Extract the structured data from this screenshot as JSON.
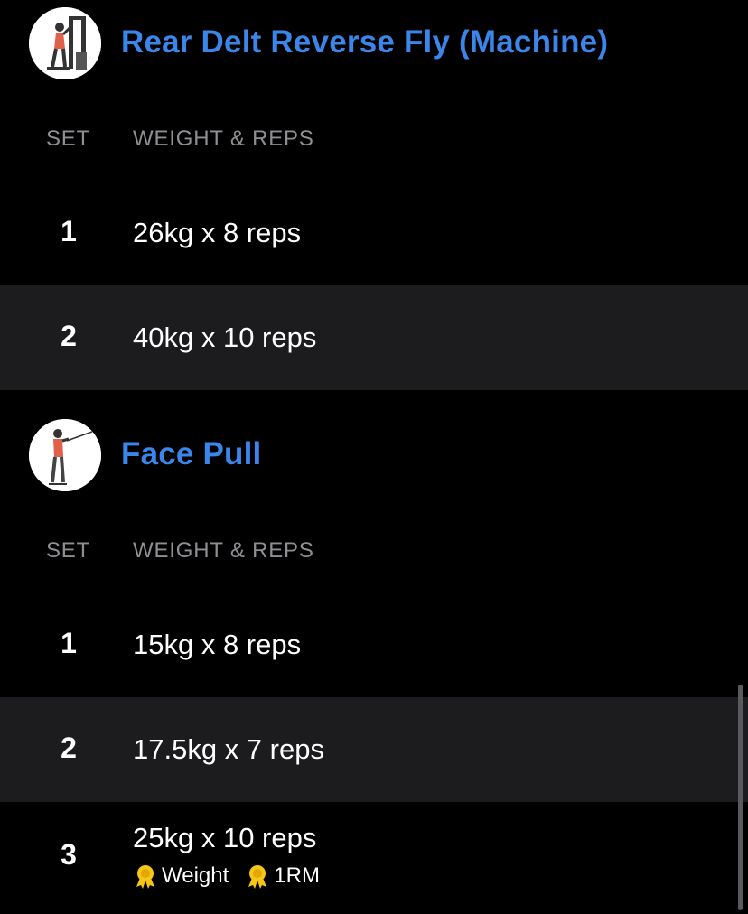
{
  "column_headers": {
    "set": "SET",
    "weight_reps": "WEIGHT & REPS"
  },
  "exercises": [
    {
      "name": "Rear Delt Reverse Fly (Machine)",
      "thumbnail_icon": "machine-exercise-icon",
      "sets": [
        {
          "number": "1",
          "value": "26kg x 8 reps"
        },
        {
          "number": "2",
          "value": "40kg x 10 reps"
        }
      ]
    },
    {
      "name": "Face Pull",
      "thumbnail_icon": "cable-exercise-icon",
      "sets": [
        {
          "number": "1",
          "value": "15kg x 8 reps"
        },
        {
          "number": "2",
          "value": "17.5kg x 7 reps"
        },
        {
          "number": "3",
          "value": "25kg x 10 reps",
          "badges": [
            "Weight",
            "1RM"
          ]
        }
      ]
    }
  ],
  "colors": {
    "accent": "#3b86ea",
    "background": "#000000",
    "alt_row": "#1c1c1e",
    "muted_text": "#8e8e93",
    "badge_gold": "#f5c518"
  }
}
